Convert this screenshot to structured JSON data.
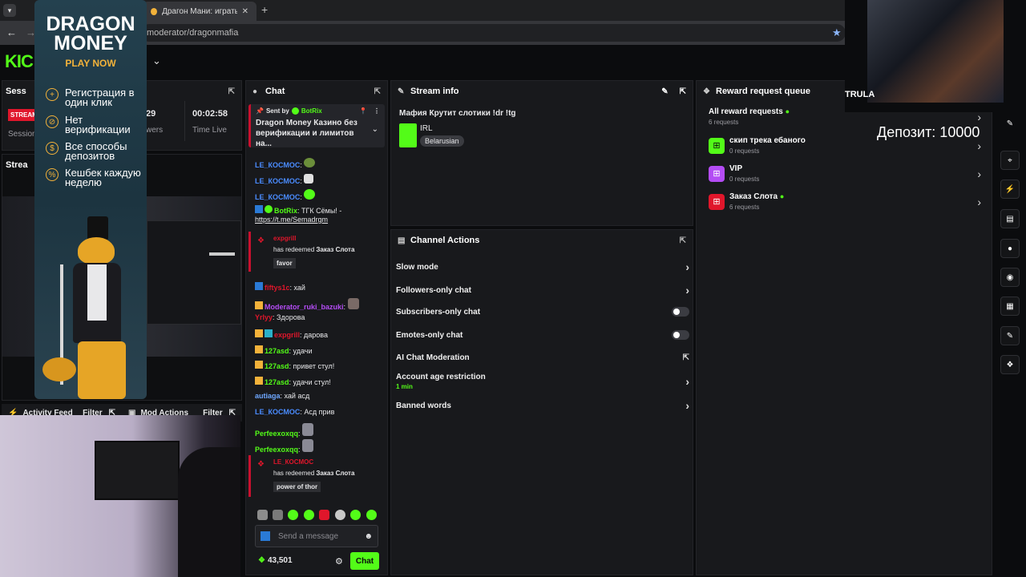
{
  "browser": {
    "tab_title": "Драгон Мани: играть в онлайн",
    "url": "moderator/dragonmafia",
    "new_tab": "+"
  },
  "site": {
    "logo": "KIC"
  },
  "session": {
    "title": "Sess",
    "stream_badge": "STREAM",
    "viewers_value": "29",
    "viewers_label": "wers",
    "time_value": "00:02:58",
    "time_label": "Time Live",
    "session_label": "Session",
    "stream_label": "Strea"
  },
  "chat": {
    "title": "Chat",
    "pinned": {
      "sent_by": "Sent by",
      "user": "BotRix",
      "text": "Dragon Money Казино без верификации и лимитов на..."
    },
    "messages": [
      {
        "user": "LE_КОСМОС",
        "text": ""
      },
      {
        "user": "LE_КОСМОС",
        "text": ""
      },
      {
        "user": "LE_КОСМОС",
        "text": ""
      },
      {
        "user": "BotRix",
        "text": "ТГК Сёмы! -"
      },
      {
        "user": "",
        "text": "https://t.me/Semadrgm"
      },
      {
        "user": "fiftys1c",
        "text": "хай"
      },
      {
        "user": "Moderator_ruki_bazuki",
        "text": ""
      },
      {
        "user": "Yrlyy",
        "text": "Здорова"
      },
      {
        "user": "expgrill",
        "text": "дарова"
      },
      {
        "user": "127asd",
        "text": "удачи"
      },
      {
        "user": "127asd",
        "text": "привет стул!"
      },
      {
        "user": "127asd",
        "text": "удачи стул!"
      },
      {
        "user": "autiaga",
        "text": "хай асд"
      },
      {
        "user": "LE_КОСМОС",
        "text": "Асд прив"
      },
      {
        "user": "Perfeexoxqq",
        "text": ""
      },
      {
        "user": "Perfeexoxqq",
        "text": ""
      }
    ],
    "redeem1": {
      "user": "expgrill",
      "action": "has redeemed",
      "reward": "Заказ Слота",
      "note": "favor"
    },
    "redeem2": {
      "user": "LE_КОСМОС",
      "action": "has redeemed",
      "reward": "Заказ Слота",
      "note": "power of thor"
    },
    "input_placeholder": "Send a message",
    "points": "43,501",
    "send_label": "Chat"
  },
  "stream_info": {
    "title": "Stream info",
    "stream_title": "Мафия Крутит слотики !dr !tg",
    "category": "IRL",
    "tag": "Belarusian"
  },
  "channel_actions": {
    "title": "Channel Actions",
    "slow": "Slow mode",
    "followers": "Followers-only chat",
    "subscribers": "Subscribers-only chat",
    "emotes": "Emotes-only chat",
    "ai": "AI Chat Moderation",
    "age": "Account age restriction",
    "age_value": "1 min",
    "banned": "Banned words"
  },
  "rewards": {
    "title": "Reward request queue",
    "items": [
      {
        "label": "All reward requests",
        "count": "6 requests"
      },
      {
        "label": "скип трека ебаного",
        "count": "0 requests"
      },
      {
        "label": "VIP",
        "count": "0 requests"
      },
      {
        "label": "Заказ Слота",
        "count": "6 requests"
      }
    ]
  },
  "activity": {
    "title": "Activity Feed",
    "filter": "Filter"
  },
  "modactions": {
    "title": "Mod Actions",
    "filter": "Filter"
  },
  "overlay": {
    "deposit": "Депозит: 10000",
    "cam_name": "TRULA"
  },
  "ad": {
    "brand1": "DRAGON",
    "brand2": "MONEY",
    "cta": "PLAY NOW",
    "f1": "Регистрация в один клик",
    "f2": "Нет верификации",
    "f3": "Все способы депозитов",
    "f4": "Кешбек каждую неделю"
  },
  "colors": {
    "accent": "#53fc18",
    "ad_bg": "#1f3946",
    "ad_gold": "#f3b23a"
  }
}
